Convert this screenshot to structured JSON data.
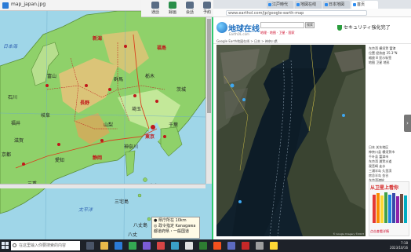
{
  "map_window": {
    "title": "map_japan.jpg",
    "minimize": "–",
    "maximize": "□",
    "close": "×",
    "labels": {
      "ishikawa": "石川",
      "toyama": "富山",
      "niigata": "新潟",
      "fukushima": "福島",
      "nagano": "長野",
      "gifu": "岐阜",
      "gunma": "群馬",
      "tochigi": "栃木",
      "ibaraki": "茨城",
      "saitama": "埼玉",
      "tokyo": "東京",
      "chiba": "千葉",
      "kanagawa": "神奈川",
      "yamanashi": "山梨",
      "shizuoka": "静岡",
      "aichi": "愛知",
      "mie": "三重",
      "shiga": "滋賀",
      "fukui": "福井",
      "kyoto": "京都",
      "sea_pacific": "太平洋",
      "sea_japan": "日本海",
      "hachijo": "八丈島",
      "hachijo2": "八丈",
      "miyake": "三宅島",
      "oshima": "大島"
    },
    "legend": {
      "line1": "● 県庁所在 10km",
      "line2": "◎ 政令指定 Kanagawa",
      "line3": "都道府県・一般国道"
    }
  },
  "toolbar": {
    "btn1": "通話",
    "btn2": "録画",
    "btn3": "会話",
    "btn4": "予約",
    "btn5": "表示",
    "btn6": "設定",
    "end": "終了"
  },
  "browser": {
    "tabs": [
      "江戸時代",
      "地図在线",
      "日本地図",
      "首页"
    ],
    "address": "www.earthol.com/jp/google-earth-map",
    "site": {
      "logo": "地球在线",
      "logo_sub": "EarthOL.com",
      "search_button": "搜索",
      "header_links": "地理 · 地图 · 卫星 · 国家",
      "ad_text": "セキュリティ強化完了",
      "breadcrumb": "Google Earth地図在线 > 日本 > 神奈川県"
    },
    "satellite": {
      "attribution": "© Google  Imagery ©2023"
    },
    "side_panel": {
      "lines": [
        "东京湾 横须贺 富津",
        "位置 经纬度 35.3°N",
        "缩放 8   显示标签",
        "地图  卫星  地形"
      ],
      "lines2": [
        "日本 关东地区",
        "神奈川县 横须贺市",
        "千叶县 富津市",
        "东京湾 浦贺水道",
        "观音崎 走水",
        "三浦半岛 久里滨",
        "房总半岛 金谷",
        "东京湾渡轮"
      ]
    },
    "promo": {
      "title": "从卫星上看你",
      "footer": "点击查看详情"
    },
    "scroll_arrow": "›"
  },
  "taskbar": {
    "search_placeholder": "在这里输入你要搜索的内容",
    "time": "7:18",
    "date": "2023/10/16"
  },
  "colors": {
    "land_green": "#8fd16a",
    "sea_blue": "#9fd6e8",
    "prefecture_red": "#c0171b",
    "accent_green": "#2ec96e"
  }
}
